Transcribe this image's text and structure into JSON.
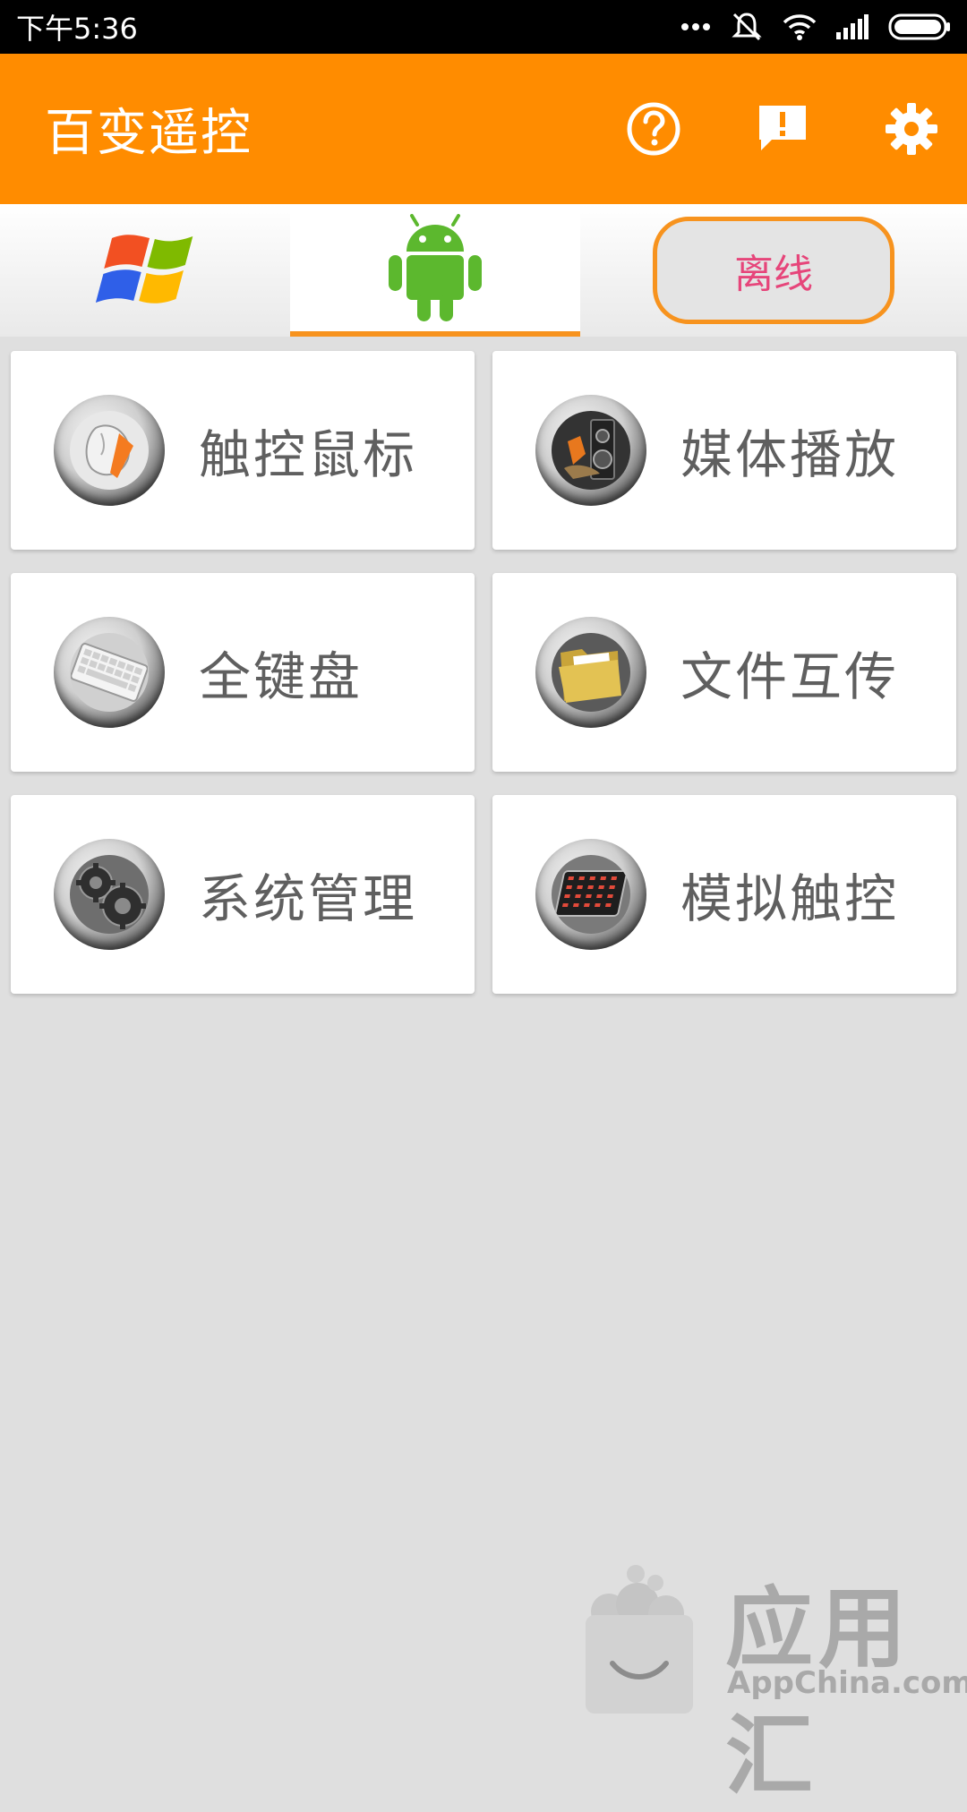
{
  "status_bar": {
    "time": "下午5:36",
    "icons": [
      "more-dots-icon",
      "mute-icon",
      "wifi-icon",
      "signal-icon",
      "battery-icon"
    ]
  },
  "app_bar": {
    "title": "百变遥控",
    "actions": [
      "help-icon",
      "feedback-icon",
      "settings-icon"
    ],
    "background": "#ff8c00"
  },
  "tabs": {
    "windows_icon": "windows-logo-icon",
    "android_icon": "android-robot-icon",
    "active": "android",
    "status_label": "离线",
    "status_color": "#e6457a",
    "accent": "#f7931e"
  },
  "cards": [
    {
      "label": "触控鼠标",
      "icon": "mouse-icon"
    },
    {
      "label": "媒体播放",
      "icon": "media-speaker-icon"
    },
    {
      "label": "全键盘",
      "icon": "keyboard-icon"
    },
    {
      "label": "文件互传",
      "icon": "folder-icon"
    },
    {
      "label": "系统管理",
      "icon": "gears-icon"
    },
    {
      "label": "模拟触控",
      "icon": "touchpad-icon"
    }
  ],
  "watermark": {
    "title": "应用汇",
    "subtitle": "AppChina.com"
  }
}
